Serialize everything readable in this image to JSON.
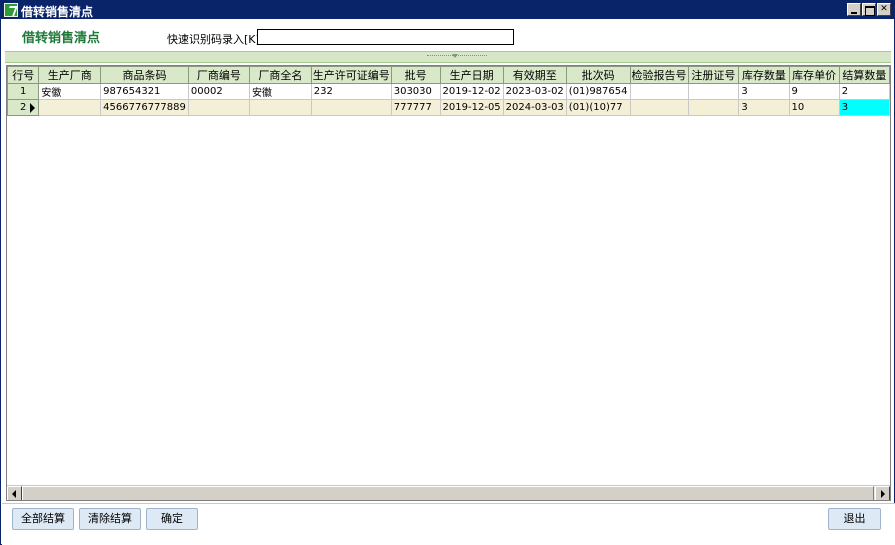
{
  "window": {
    "title": "借转销售清点",
    "minimize_icon": "minimize-icon",
    "maximize_icon": "maximize-icon",
    "close_icon": "close-icon",
    "close_glyph": "✕"
  },
  "header": {
    "title": "借转销售清点",
    "scan_label": "快速识别码录入[K]",
    "scan_value": ""
  },
  "grid": {
    "columns": [
      "行号",
      "生产厂商",
      "商品条码",
      "厂商编号",
      "厂商全名",
      "生产许可证编号",
      "批号",
      "生产日期",
      "有效期至",
      "批次码",
      "检验报告号",
      "注册证号",
      "库存数量",
      "库存单价",
      "结算数量"
    ],
    "rows": [
      {
        "cells": [
          "1",
          "安徽",
          "987654321",
          "00002",
          "安徽",
          "232",
          "303030",
          "2019-12-02",
          "2023-03-02",
          "(01)987654",
          "",
          "",
          "3",
          "9",
          "2"
        ]
      },
      {
        "cells": [
          "2",
          "",
          "4566776777889",
          "",
          "",
          "",
          "777777",
          "2019-12-05",
          "2024-03-03",
          "(01)(10)77",
          "",
          "",
          "3",
          "10",
          "3"
        ]
      }
    ],
    "current_row": 2,
    "selected_cell": {
      "row": 2,
      "column": "结算数量"
    }
  },
  "buttons": {
    "settle_all": "全部结算",
    "clear_settle": "清除结算",
    "confirm": "确定",
    "exit": "退出"
  },
  "colors": {
    "title_bar": "#0a246a",
    "header_title": "#1f7a3a",
    "grid_header": "#d8e8c8",
    "alt_row": "#f4f0d8",
    "selected_cell": "#00ffff",
    "button": "#dde9f5"
  }
}
